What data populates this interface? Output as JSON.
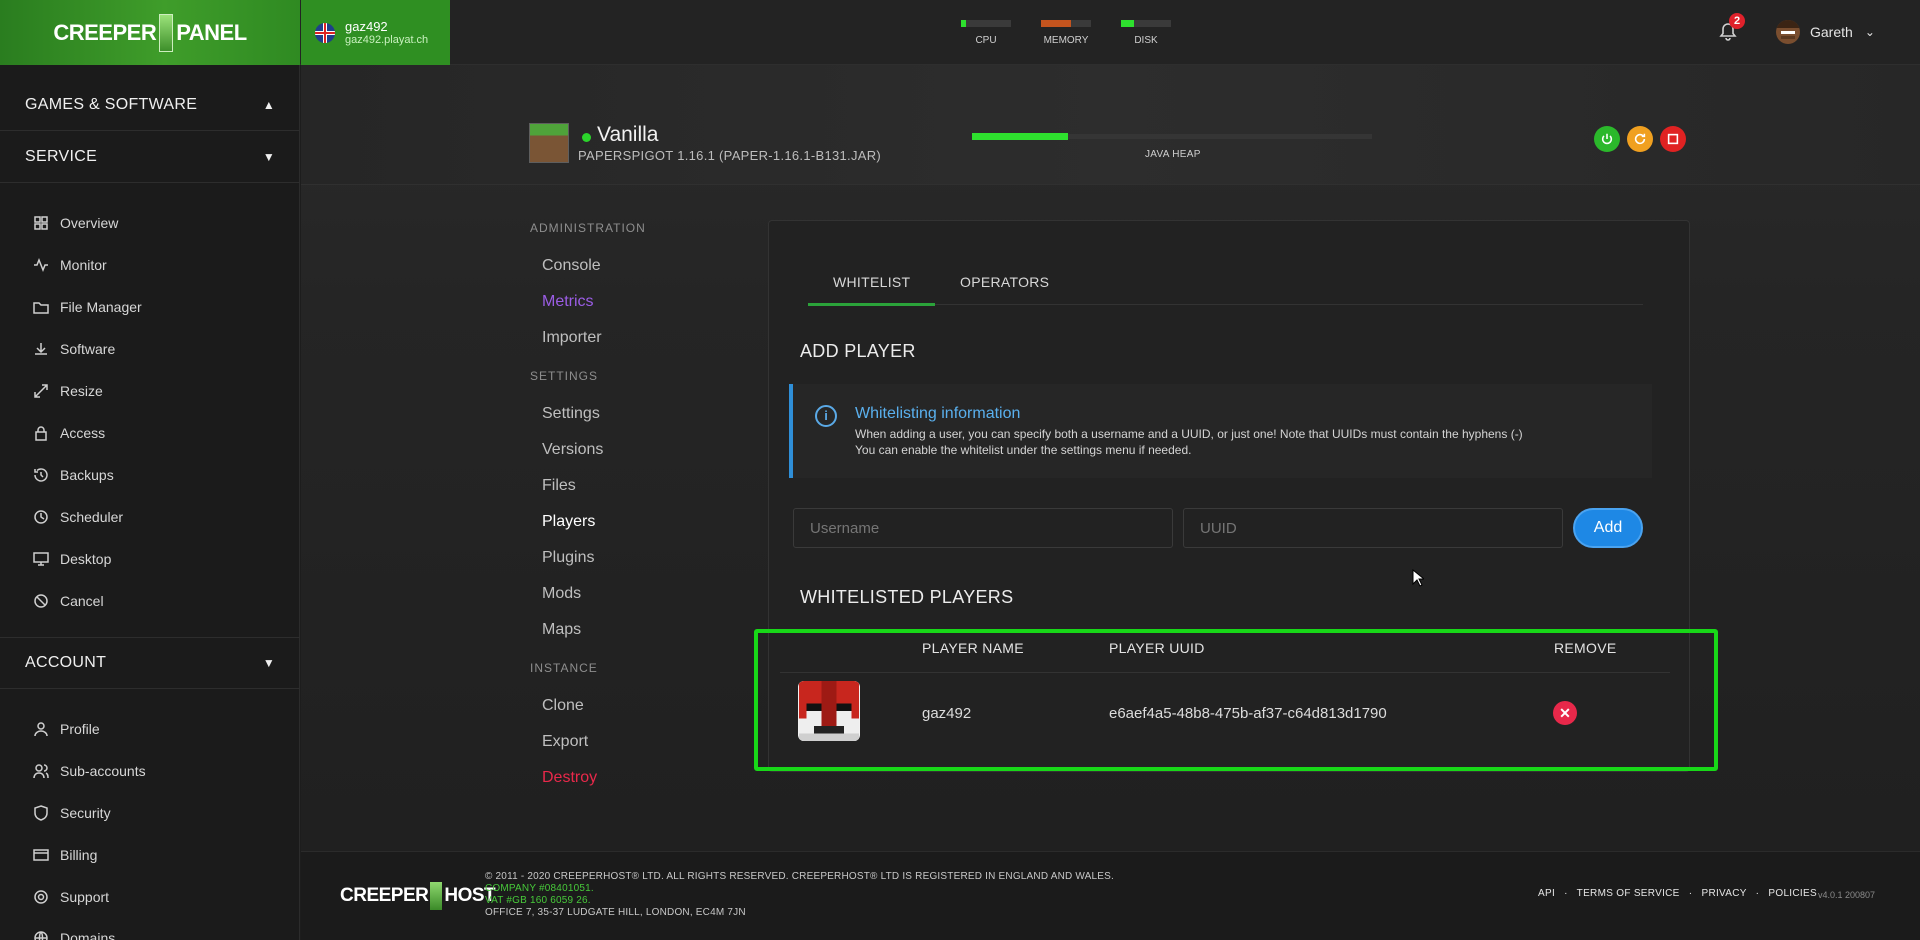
{
  "brand": {
    "logo_left": "CREEPER",
    "logo_right": "PANEL"
  },
  "server": {
    "name": "gaz492",
    "host": "gaz492.playat.ch"
  },
  "meters": [
    {
      "label": "CPU",
      "fill": 0.1,
      "color": "#2ee02e"
    },
    {
      "label": "MEMORY",
      "fill": 0.6,
      "color": "#c4541e"
    },
    {
      "label": "DISK",
      "fill": 0.25,
      "color": "#2ee02e"
    }
  ],
  "notifications": {
    "count": "2"
  },
  "user": {
    "name": "Gareth"
  },
  "sidebar": {
    "sections": [
      "GAMES & SOFTWARE",
      "SERVICE",
      "ACCOUNT"
    ],
    "service_items": [
      "Overview",
      "Monitor",
      "File Manager",
      "Software",
      "Resize",
      "Access",
      "Backups",
      "Scheduler",
      "Desktop",
      "Cancel"
    ],
    "account_items": [
      "Profile",
      "Sub-accounts",
      "Security",
      "Billing",
      "Support",
      "Domains"
    ]
  },
  "instance": {
    "title": "Vanilla",
    "subtitle": "PAPERSPIGOT 1.16.1 (PAPER-1.16.1-B131.JAR)",
    "heap_label": "JAVA HEAP",
    "heap_fill": 0.24
  },
  "subnav": {
    "admin_head": "ADMINISTRATION",
    "admin": [
      "Console",
      "Metrics",
      "Importer"
    ],
    "settings_head": "SETTINGS",
    "settings": [
      "Settings",
      "Versions",
      "Files",
      "Players",
      "Plugins",
      "Mods",
      "Maps"
    ],
    "instance_head": "INSTANCE",
    "instance": [
      "Clone",
      "Export",
      "Destroy"
    ]
  },
  "tabs": [
    "WHITELIST",
    "OPERATORS"
  ],
  "add_player": {
    "heading": "ADD PLAYER",
    "info_title": "Whitelisting information",
    "info_line1": "When adding a user, you can specify both a username and a UUID, or just one! Note that UUIDs must contain the hyphens (-)",
    "info_line2": "You can enable the whitelist under the settings menu if needed.",
    "username_placeholder": "Username",
    "uuid_placeholder": "UUID",
    "add_label": "Add"
  },
  "whitelist": {
    "heading": "WHITELISTED PLAYERS",
    "columns": [
      "PLAYER NAME",
      "PLAYER UUID",
      "REMOVE"
    ],
    "rows": [
      {
        "name": "gaz492",
        "uuid": "e6aef4a5-48b8-475b-af37-c64d813d1790"
      }
    ]
  },
  "footer": {
    "copyright": "© 2011 - 2020 CREEPERHOST® LTD. ALL RIGHTS RESERVED. CREEPERHOST® LTD IS REGISTERED IN ENGLAND AND WALES.",
    "company": "COMPANY #08401051.",
    "vat": "VAT #GB 160 6059 26.",
    "address": "OFFICE 7, 35-37 LUDGATE HILL, LONDON, EC4M 7JN",
    "links": [
      "API",
      "TERMS OF SERVICE",
      "PRIVACY",
      "POLICIES"
    ],
    "version": "v4.0.1 200807",
    "logo_left": "CREEPER",
    "logo_right": "HOST"
  }
}
